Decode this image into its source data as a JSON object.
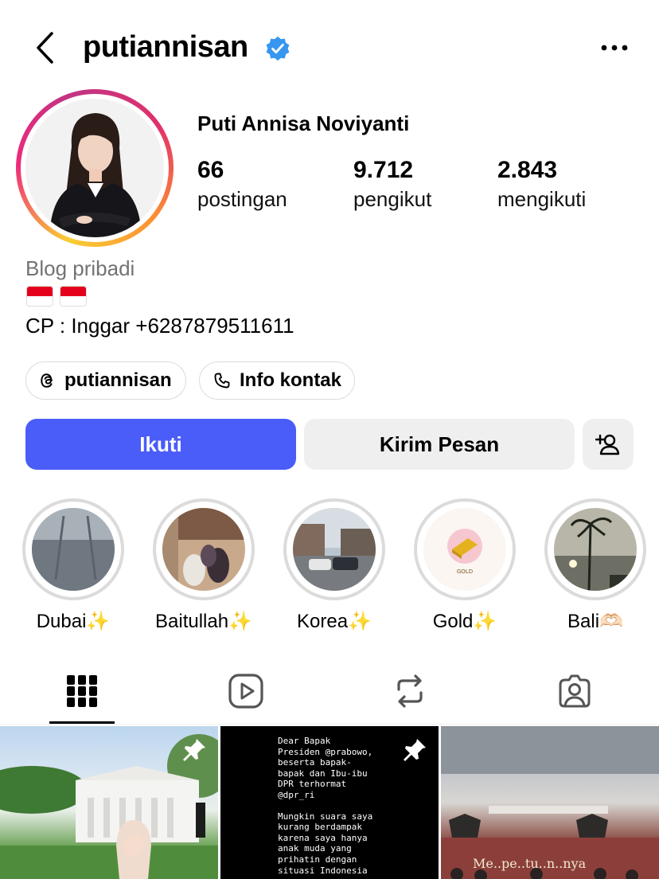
{
  "header": {
    "username": "putiannisan",
    "verified": true
  },
  "profile": {
    "full_name": "Puti Annisa Noviyanti",
    "stats": [
      {
        "value": "66",
        "label": "postingan"
      },
      {
        "value": "9.712",
        "label": "pengikut"
      },
      {
        "value": "2.843",
        "label": "mengikuti"
      }
    ],
    "bio": {
      "category": "Blog pribadi",
      "flags": "🇮🇩 🇮🇩",
      "contact": "CP : Inggar +6287879511611"
    },
    "links": {
      "threads": "putiannisan",
      "contact_info": "Info kontak"
    }
  },
  "actions": {
    "follow": "Ikuti",
    "message": "Kirim Pesan"
  },
  "highlights": [
    {
      "label": "Dubai✨"
    },
    {
      "label": "Baitullah✨"
    },
    {
      "label": "Korea✨"
    },
    {
      "label": "Gold✨"
    },
    {
      "label": "Bali🫶🏻"
    }
  ],
  "highlight_gold_text": "GOLD",
  "tabs": [
    "grid-icon",
    "reels-icon",
    "reposts-icon",
    "tagged-icon"
  ],
  "posts": {
    "post2_text_p1": "Dear Bapak\nPresiden @prabowo,\nbeserta bapak-\nbapak dan Ibu-ibu\nDPR terhormat\n@dpr_ri",
    "post2_text_p2": "Mungkin suara saya\nkurang berdampak\nkarena saya hanya\nanak muda yang\nprihatin dengan\nsituasi Indonesia",
    "post3_banner": "Me..pe..tu..n..nya"
  },
  "colors": {
    "follow_button": "#4a5df9",
    "secondary_button": "#efefef",
    "verified_badge": "#3797f0",
    "muted_text": "#737373"
  }
}
